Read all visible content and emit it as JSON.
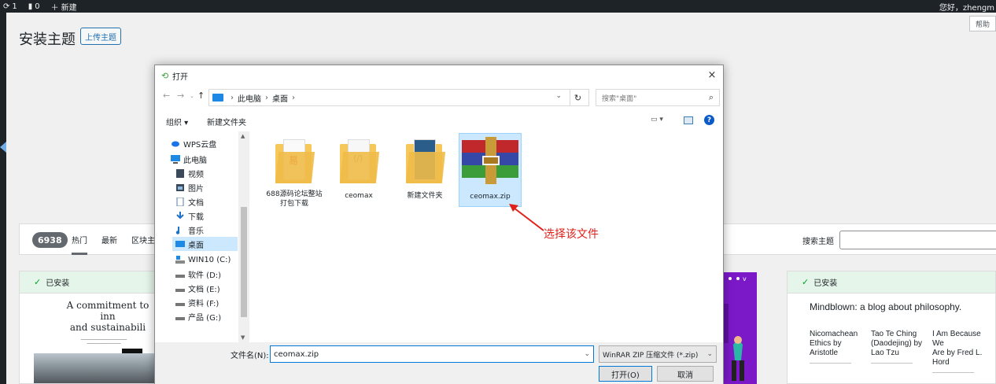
{
  "admin_bar": {
    "updates_count": "1",
    "comments_count": "0",
    "new_label": "新建",
    "greeting": "您好，zhengm"
  },
  "page": {
    "title": "安装主题",
    "upload_button": "上传主题",
    "help_button": "帮助"
  },
  "filters": {
    "count": "6938",
    "tabs": [
      "热门",
      "最新",
      "区块主"
    ],
    "search_label": "搜索主题",
    "search_value": ""
  },
  "themes": [
    {
      "installed_label": "已安装",
      "headline_lines": [
        "A commitment to inn",
        "and sustainabili"
      ]
    },
    {
      "installed_label": "已安装",
      "headline": "Mindblown: a blog about philosophy.",
      "columns": [
        [
          "Nicomachean",
          "Ethics by",
          "Aristotle"
        ],
        [
          "Tao Te Ching",
          "(Daodejing) by",
          "Lao Tzu"
        ],
        [
          "I Am Because We",
          "Are by Fred L.",
          "Hord"
        ]
      ]
    }
  ],
  "dialog": {
    "title": "打开",
    "close_icon": "×",
    "breadcrumb": [
      "此电脑",
      "桌面"
    ],
    "search_placeholder": "搜索\"桌面\"",
    "toolbar": {
      "organize": "组织 ▾",
      "new_folder": "新建文件夹",
      "help_glyph": "?"
    },
    "nav_items": [
      {
        "label": "WPS云盘",
        "icon": "cloud-icon"
      },
      {
        "label": "此电脑",
        "icon": "computer-icon"
      },
      {
        "label": "视频",
        "icon": "video-icon"
      },
      {
        "label": "图片",
        "icon": "picture-icon"
      },
      {
        "label": "文档",
        "icon": "document-icon"
      },
      {
        "label": "下载",
        "icon": "download-icon"
      },
      {
        "label": "音乐",
        "icon": "music-icon"
      },
      {
        "label": "桌面",
        "icon": "desktop-icon"
      },
      {
        "label": "WIN10 (C:)",
        "icon": "drive-icon"
      },
      {
        "label": "软件 (D:)",
        "icon": "drive-icon"
      },
      {
        "label": "文档 (E:)",
        "icon": "drive-icon"
      },
      {
        "label": "资料 (F:)",
        "icon": "drive-icon"
      },
      {
        "label": "产品 (G:)",
        "icon": "drive-icon"
      }
    ],
    "files": [
      {
        "name": "688源码论坛整站打包下载",
        "type": "folder"
      },
      {
        "name": "ceomax",
        "type": "folder"
      },
      {
        "name": "新建文件夹",
        "type": "folder"
      },
      {
        "name": "ceomax.zip",
        "type": "winrar-archive"
      }
    ],
    "filename_label": "文件名(N):",
    "filename_value": "ceomax.zip",
    "filetype_value": "WinRAR ZIP 压缩文件 (*.zip)",
    "open_button": "打开(O)",
    "cancel_button": "取消"
  },
  "annotation": {
    "text": "选择该文件",
    "color": "#e0201b"
  },
  "colors": {
    "wp_admin_bar": "#1d2327",
    "wp_blue": "#2271b1",
    "selection": "#cce8ff",
    "installed_bg": "#e5f5ea",
    "purple_theme": "#7b19c9"
  }
}
